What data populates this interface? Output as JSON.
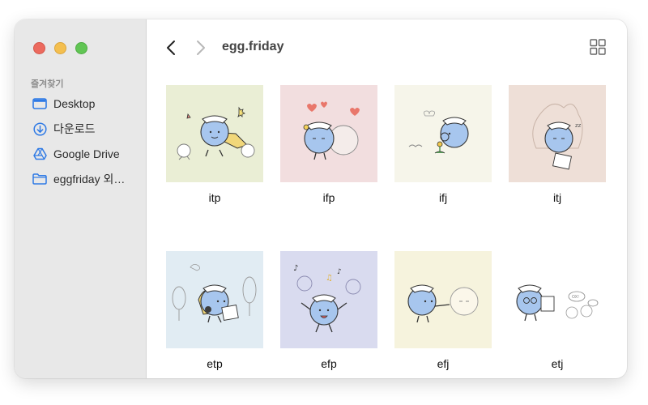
{
  "sidebar": {
    "section_title": "즐겨찾기",
    "items": [
      {
        "label": "Desktop",
        "icon": "desktop-icon"
      },
      {
        "label": "다운로드",
        "icon": "download-icon"
      },
      {
        "label": "Google Drive",
        "icon": "google-drive-icon"
      },
      {
        "label": "eggfriday 외…",
        "icon": "folder-icon"
      }
    ]
  },
  "toolbar": {
    "title": "egg.friday",
    "back_icon": "chevron-left-icon",
    "forward_icon": "chevron-right-icon",
    "view_icon": "grid-view-icon"
  },
  "files": [
    {
      "name": "itp",
      "bg": "#eaeed5"
    },
    {
      "name": "ifp",
      "bg": "#f2dedf"
    },
    {
      "name": "ifj",
      "bg": "#f6f5ea"
    },
    {
      "name": "itj",
      "bg": "#eedfd7"
    },
    {
      "name": "etp",
      "bg": "#e1ecf3"
    },
    {
      "name": "efp",
      "bg": "#d9dbef"
    },
    {
      "name": "efj",
      "bg": "#f6f3dd"
    },
    {
      "name": "etj",
      "bg": "#ffffff"
    }
  ],
  "colors": {
    "character_blue": "#a7c6ee",
    "outline": "#333333",
    "sidebar_bg": "#e8e8e8"
  }
}
